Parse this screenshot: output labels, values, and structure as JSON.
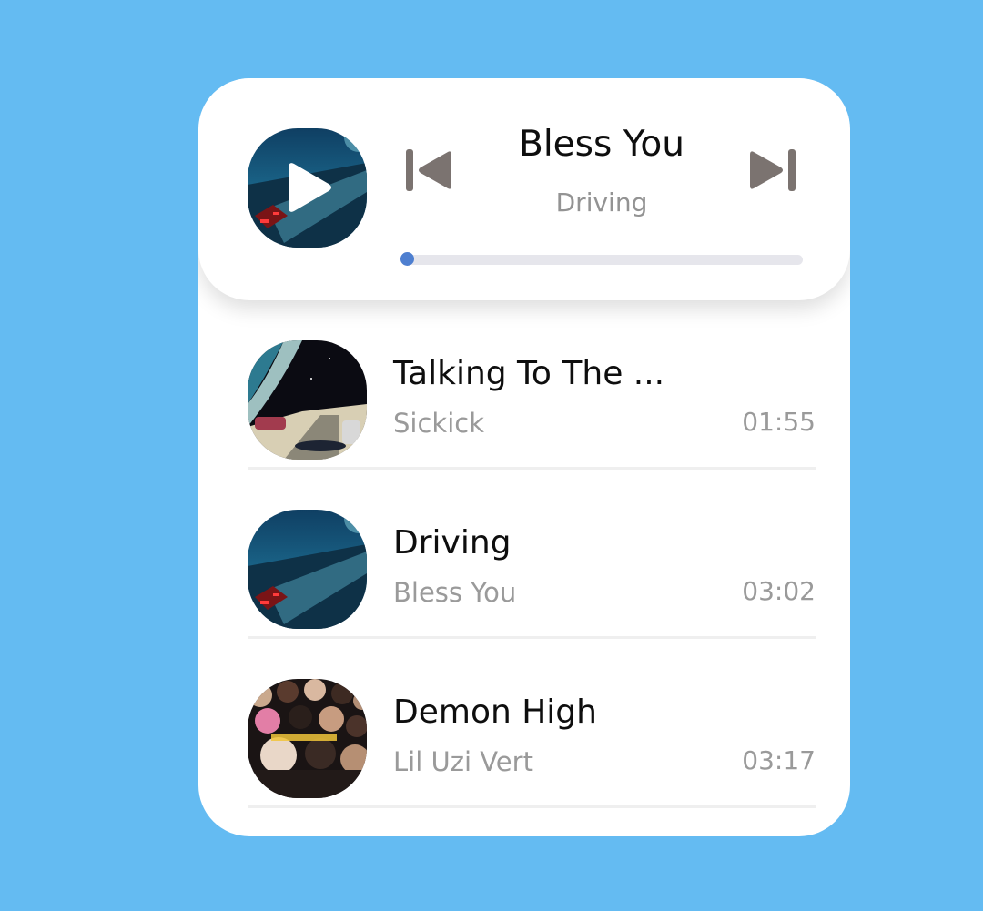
{
  "now_playing": {
    "title": "Bless You",
    "artist": "Driving",
    "progress_fraction": 0.015,
    "controls": {
      "previous_icon": "skip-previous-icon",
      "play_icon": "play-icon",
      "next_icon": "skip-next-icon"
    }
  },
  "tracks": [
    {
      "title": "Talking To The ...",
      "artist": "Sickick",
      "duration": "01:55"
    },
    {
      "title": "Driving",
      "artist": "Bless You",
      "duration": "03:02"
    },
    {
      "title": "Demon High",
      "artist": "Lil Uzi Vert",
      "duration": "03:17"
    }
  ],
  "colors": {
    "background": "#64bbf2",
    "card": "#ffffff",
    "progress_thumb": "#4e7fd0",
    "progress_track": "#e6e6ec",
    "control_icons": "#7b7370",
    "title_text": "#0e0e0e",
    "secondary_text": "#9a9a9a"
  }
}
